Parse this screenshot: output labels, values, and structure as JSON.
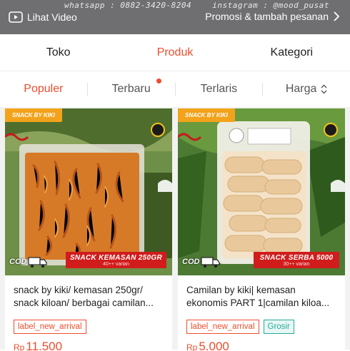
{
  "banner": {
    "watermark_left": "whatsapp : 0882-3420-8204",
    "watermark_right": "instagram : @mood_pusat",
    "lihat_video": "Lihat Video",
    "promo": "Promosi & tambah pesanan"
  },
  "tabs": [
    {
      "label": "Toko",
      "active": false
    },
    {
      "label": "Produk",
      "active": true
    },
    {
      "label": "Kategori",
      "active": false
    }
  ],
  "sort": [
    {
      "label": "Populer",
      "active": true
    },
    {
      "label": "Terbaru",
      "dot": true
    },
    {
      "label": "Terlaris"
    },
    {
      "label": "Harga",
      "icon": "sort-updown-icon"
    }
  ],
  "products": [
    {
      "image_tag": "SNACK BY KIKI",
      "cod": "COD",
      "pack_title": "SNACK KEMASAN 250GR",
      "pack_sub": "40++ varian",
      "title": "snack by kiki/ kemasan 250gr/ snack kiloan/ berbagai camilan...",
      "labels": [
        "label_new_arrival"
      ],
      "currency": "Rp",
      "price": "11.500"
    },
    {
      "image_tag": "SNACK BY KIKI",
      "cod": "COD",
      "pack_title": "SNACK SERBA 5000",
      "pack_sub": "30++ varian",
      "title": "Camilan by kiki| kemasan ekonomis PART 1|camilan kiloa...",
      "labels": [
        "label_new_arrival",
        "Grosir"
      ],
      "currency": "Rp",
      "price": "5.000"
    }
  ],
  "colors": {
    "accent": "#ee4d2d",
    "grosir": "#26aa99",
    "banner": "#6f6f72",
    "tag": "#f2a31b",
    "pack": "#d11c1c"
  }
}
